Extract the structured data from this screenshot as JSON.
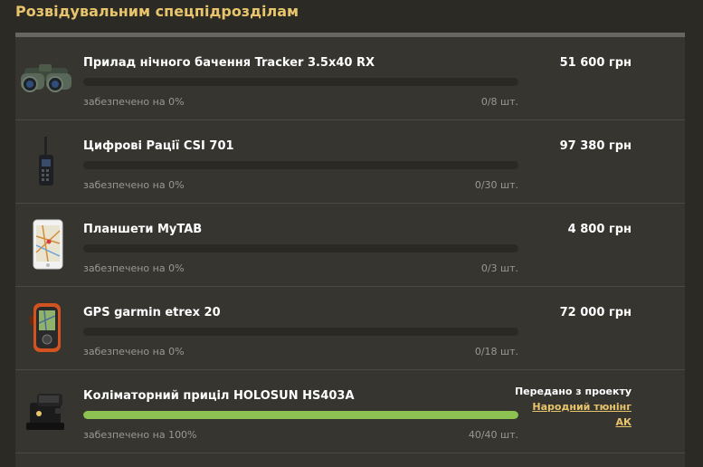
{
  "page": {
    "title": "Розвідувальним спецпідрозділам"
  },
  "items": [
    {
      "icon": "binoculars-icon",
      "title": "Прилад нічного бачення Tracker 3.5x40 RX",
      "price": "51 600 грн",
      "provided_text": "забезпечено на 0%",
      "progress": 0,
      "count": "0/8 шт."
    },
    {
      "icon": "radio-icon",
      "title": "Цифрові Рації CSI 701",
      "price": "97 380 грн",
      "provided_text": "забезпечено на 0%",
      "progress": 0,
      "count": "0/30 шт."
    },
    {
      "icon": "tablet-icon",
      "title": "Планшети MyTAB",
      "price": "4 800 грн",
      "provided_text": "забезпечено на 0%",
      "progress": 0,
      "count": "0/3 шт."
    },
    {
      "icon": "gps-device-icon",
      "title": "GPS garmin etrex 20",
      "price": "72 000 грн",
      "provided_text": "забезпечено на 0%",
      "progress": 0,
      "count": "0/18 шт."
    },
    {
      "icon": "collimator-sight-icon",
      "title": "Коліматорний приціл HOLOSUN HS403A",
      "provided_text": "забезпечено на 100%",
      "progress": 100,
      "count": "40/40 шт.",
      "transfer_label": "Передано з проекту",
      "transfer_link_line1": "Народний тюнінг",
      "transfer_link_line2": "АК"
    }
  ],
  "colors": {
    "accent": "#e8c56c",
    "progress_fill": "#8dc152",
    "panel": "#363530",
    "background": "#2b2a25"
  }
}
